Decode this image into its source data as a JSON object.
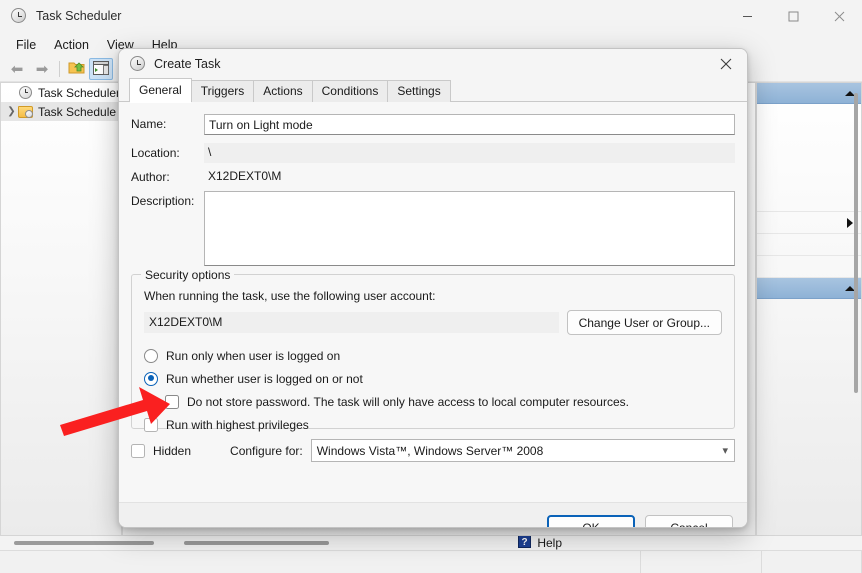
{
  "main_window": {
    "title": "Task Scheduler",
    "title_icon": "clock-icon",
    "menu": [
      {
        "label": "File"
      },
      {
        "label": "Action"
      },
      {
        "label": "View"
      },
      {
        "label": "Help"
      }
    ],
    "toolbar": [
      {
        "name": "back-button",
        "icon": "left-arrow-icon"
      },
      {
        "name": "forward-button",
        "icon": "right-arrow-icon"
      },
      {
        "name": "show-hide-console-tree-button",
        "icon": "folder-up-icon"
      },
      {
        "name": "show-hide-action-pane-button",
        "icon": "action-pane-icon"
      }
    ],
    "window_controls": {
      "minimize": "minimize-icon",
      "maximize": "maximize-icon",
      "close": "close-icon"
    },
    "tree": [
      {
        "label": "Task Scheduler (L",
        "icon": "clock-icon",
        "indent": 0,
        "expandable": false,
        "selected": false
      },
      {
        "label": "Task Schedule",
        "icon": "folder-clock-icon",
        "indent": 1,
        "expandable": true,
        "selected": true
      }
    ],
    "actions_pane": {
      "header_caret": "collapse-caret-icon",
      "submenu_caret": "submenu-caret-icon"
    },
    "status_help": "Help"
  },
  "dialog": {
    "title": "Create Task",
    "title_icon": "clock-icon",
    "close_icon": "close-icon",
    "tabs": [
      {
        "label": "General",
        "active": true
      },
      {
        "label": "Triggers",
        "active": false
      },
      {
        "label": "Actions",
        "active": false
      },
      {
        "label": "Conditions",
        "active": false
      },
      {
        "label": "Settings",
        "active": false
      }
    ],
    "fields": {
      "name_label": "Name:",
      "name_value": "Turn on Light mode",
      "name_placeholder": "",
      "location_label": "Location:",
      "location_value": "\\",
      "author_label": "Author:",
      "author_value": "X12DEXT0\\M",
      "description_label": "Description:",
      "description_value": "",
      "description_placeholder": ""
    },
    "security_options": {
      "group_title": "Security options",
      "caption": "When running the task, use the following user account:",
      "account_value": "X12DEXT0\\M",
      "change_user_button": "Change User or Group...",
      "radio_logged_on": {
        "label": "Run only when user is logged on",
        "checked": false
      },
      "radio_whether_logged_on": {
        "label": "Run whether user is logged on or not",
        "checked": true
      },
      "checkbox_no_store_password": {
        "label": "Do not store password.  The task will only have access to local computer resources.",
        "checked": false
      },
      "checkbox_highest_privileges": {
        "label": "Run with highest privileges",
        "checked": false
      }
    },
    "bottom": {
      "hidden_label": "Hidden",
      "hidden_checked": false,
      "configure_for_label": "Configure for:",
      "configure_for_value": "Windows Vista™, Windows Server™ 2008",
      "configure_for_caret": "chevron-down-icon"
    },
    "footer": {
      "ok_label": "OK",
      "cancel_label": "Cancel"
    }
  },
  "annotation": {
    "arrow_color": "#fa2020",
    "points_to": "do-not-store-password-checkbox"
  },
  "colors": {
    "accent_blue": "#0a62b8",
    "actions_header_blue": "#8eb2d6",
    "window_bg": "#f3f3f3",
    "dialog_bg": "#f7f7f7",
    "annotation_red": "#fa2020"
  }
}
